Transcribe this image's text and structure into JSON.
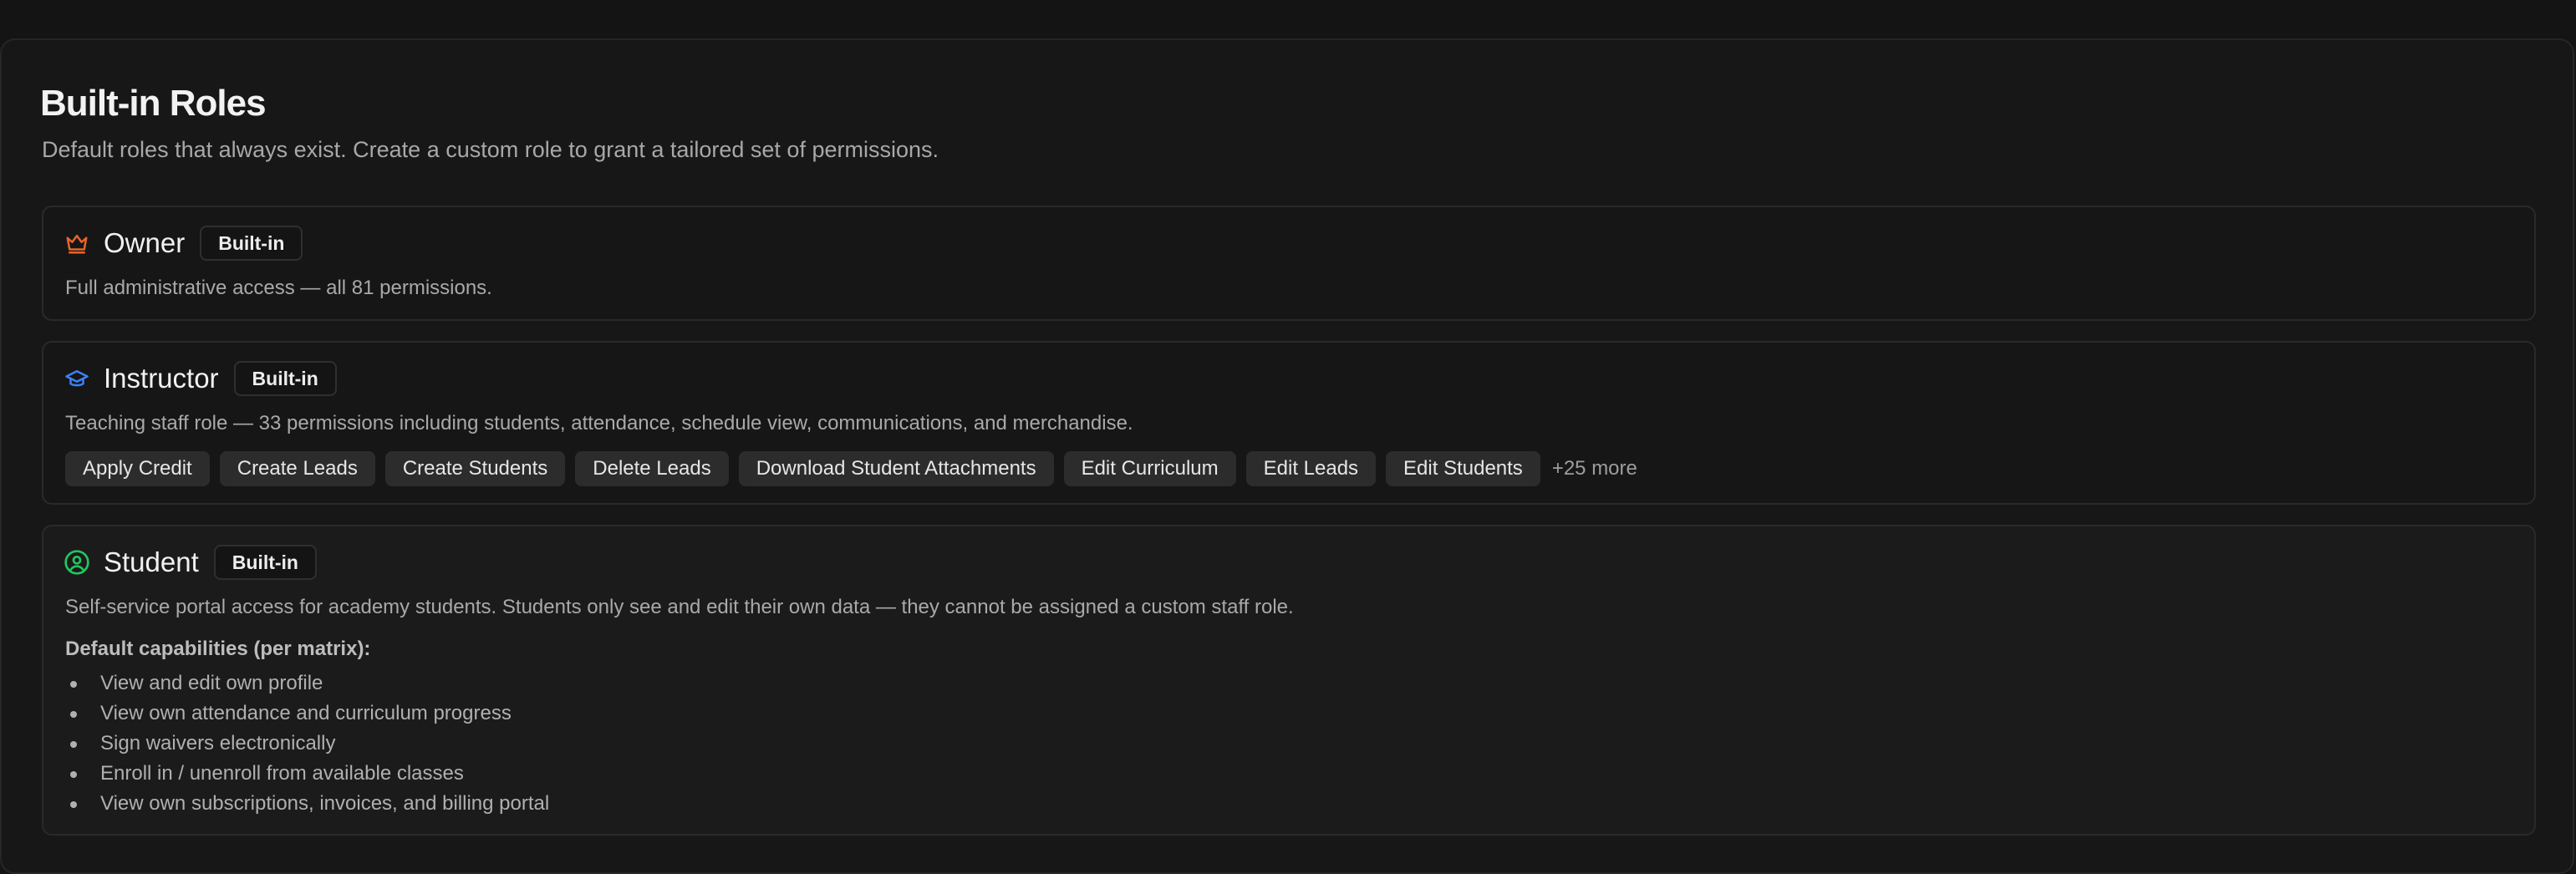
{
  "section": {
    "title": "Built-in Roles",
    "subtitle": "Default roles that always exist. Create a custom role to grant a tailored set of permissions."
  },
  "roles": {
    "owner": {
      "name": "Owner",
      "badge": "Built-in",
      "icon": "crown-icon",
      "icon_color": "#e8642c",
      "description": "Full administrative access — all 81 permissions."
    },
    "instructor": {
      "name": "Instructor",
      "badge": "Built-in",
      "icon": "graduation-cap-icon",
      "icon_color": "#3b82f6",
      "description": "Teaching staff role — 33 permissions including students, attendance, schedule view, communications, and merchandise.",
      "permissions": [
        "Apply Credit",
        "Create Leads",
        "Create Students",
        "Delete Leads",
        "Download Student Attachments",
        "Edit Curriculum",
        "Edit Leads",
        "Edit Students"
      ],
      "more_label": "+25 more"
    },
    "student": {
      "name": "Student",
      "badge": "Built-in",
      "icon": "user-circle-icon",
      "icon_color": "#22c55e",
      "description": "Self-service portal access for academy students. Students only see and edit their own data — they cannot be assigned a custom staff role.",
      "capabilities_heading": "Default capabilities (per matrix):",
      "capabilities": [
        "View and edit own profile",
        "View own attendance and curriculum progress",
        "Sign waivers electronically",
        "Enroll in / unenroll from available classes",
        "View own subscriptions, invoices, and billing portal"
      ]
    }
  }
}
